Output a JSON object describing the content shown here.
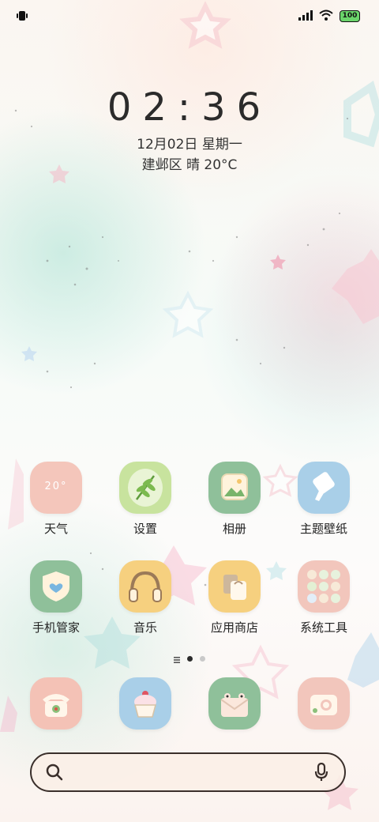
{
  "status_bar": {
    "battery": "100"
  },
  "lock": {
    "time": "02:36",
    "date": "12月02日 星期一",
    "weather": "建邺区 晴 20°C"
  },
  "weather_widget": {
    "temp": "20°"
  },
  "apps_row1": [
    {
      "label": "天气"
    },
    {
      "label": "设置"
    },
    {
      "label": "相册"
    },
    {
      "label": "主题壁纸"
    }
  ],
  "apps_row2": [
    {
      "label": "手机管家"
    },
    {
      "label": "音乐"
    },
    {
      "label": "应用商店"
    },
    {
      "label": "系统工具"
    }
  ],
  "colors": {
    "pink": "#f3c2b8",
    "green": "#a9d28c",
    "sage": "#8fc09a",
    "blue": "#a9cfe8",
    "yellow": "#f6d07f",
    "peach": "#f1c9b9"
  },
  "dock": [
    "phone-icon",
    "cupcake-icon",
    "frog-envelope-icon",
    "camera-icon"
  ]
}
